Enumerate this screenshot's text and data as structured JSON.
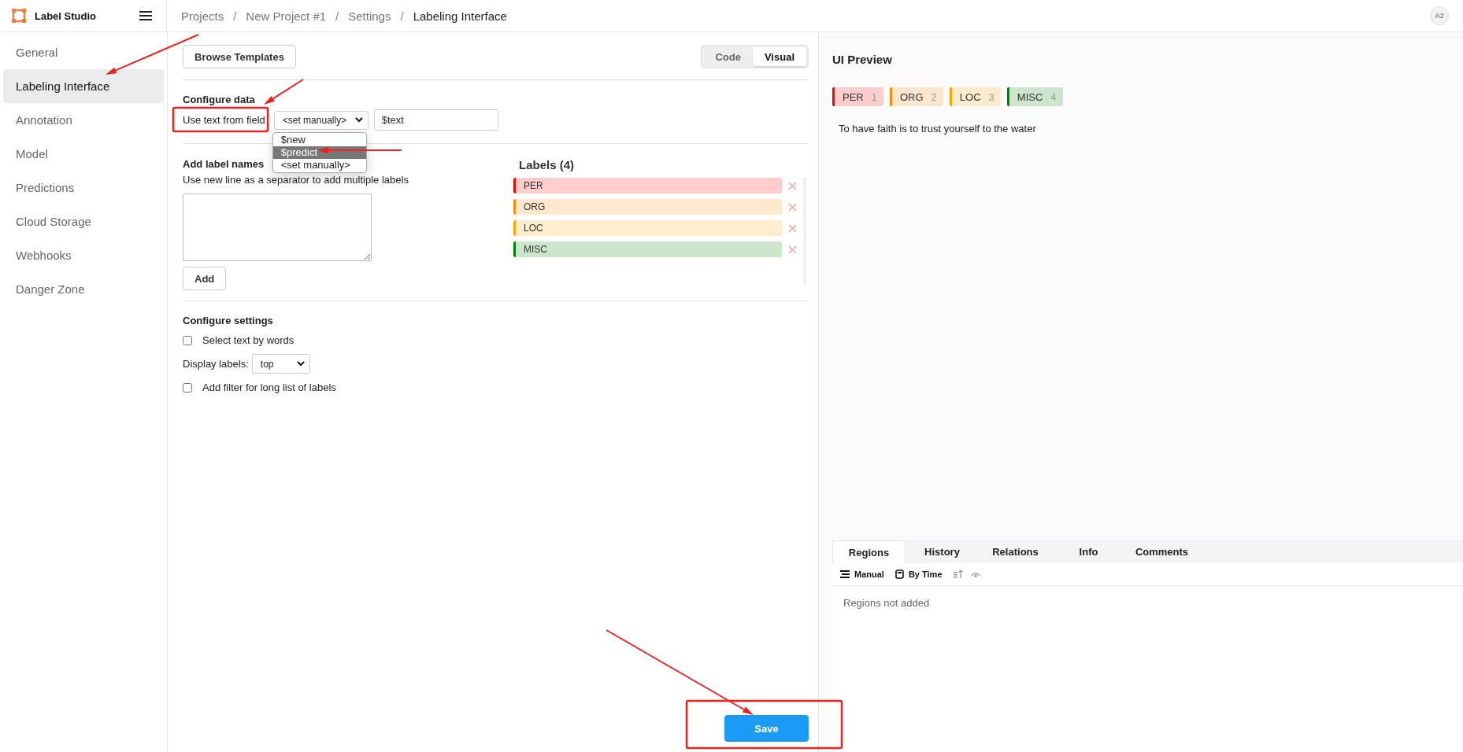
{
  "app": {
    "title": "Label Studio"
  },
  "breadcrumbs": [
    {
      "label": "Projects",
      "separator": "/"
    },
    {
      "label": "New Project #1",
      "separator": "/"
    },
    {
      "label": "Settings",
      "separator": "/"
    },
    {
      "label": "Labeling Interface"
    }
  ],
  "user": {
    "initials": "A2"
  },
  "sidebar": {
    "items": [
      {
        "label": "General",
        "selected": false
      },
      {
        "label": "Labeling Interface",
        "selected": true
      },
      {
        "label": "Annotation",
        "selected": false
      },
      {
        "label": "Model",
        "selected": false
      },
      {
        "label": "Predictions",
        "selected": false
      },
      {
        "label": "Cloud Storage",
        "selected": false
      },
      {
        "label": "Webhooks",
        "selected": false
      },
      {
        "label": "Danger Zone",
        "selected": false
      }
    ]
  },
  "toolbar": {
    "browse_button": "Browse Templates",
    "view_modes": [
      {
        "label": "Code",
        "selected": false
      },
      {
        "label": "Visual",
        "selected": true
      }
    ]
  },
  "configure_data": {
    "heading": "Configure data",
    "field_label": "Use text from field",
    "field_select": {
      "value": "<set manually>",
      "expanded": true,
      "options": [
        {
          "label": "$new",
          "highlighted": false
        },
        {
          "label": "$predict",
          "highlighted": true
        },
        {
          "label": "<set manually>",
          "highlighted": false
        }
      ]
    },
    "field_input": {
      "value": "$text"
    }
  },
  "add_labels": {
    "heading": "Add label names",
    "hint": "Use new line as a separator to add multiple labels",
    "add_button": "Add"
  },
  "labels": {
    "heading": "Labels (4)",
    "items": [
      {
        "name": "PER",
        "color": "#ff0000"
      },
      {
        "name": "ORG",
        "color": "#ff8c00"
      },
      {
        "name": "LOC",
        "color": "#ffa500"
      },
      {
        "name": "MISC",
        "color": "#008000"
      }
    ]
  },
  "configure_settings": {
    "heading": "Configure settings",
    "options": [
      {
        "kind": "checkbox",
        "label": "Select text by words",
        "checked": false
      },
      {
        "kind": "select",
        "label": "Display labels:",
        "value": "top"
      },
      {
        "kind": "checkbox",
        "label": "Add filter for long list of labels",
        "checked": false
      }
    ]
  },
  "save_button": "Save",
  "preview": {
    "title": "UI Preview",
    "tags": [
      {
        "name": "PER",
        "hotkey": "1",
        "color": "#ff0000"
      },
      {
        "name": "ORG",
        "hotkey": "2",
        "color": "#ff8c00"
      },
      {
        "name": "LOC",
        "hotkey": "3",
        "color": "#ffa500"
      },
      {
        "name": "MISC",
        "hotkey": "4",
        "color": "#008000"
      }
    ],
    "text": "To have faith is to trust yourself to the water"
  },
  "side_panel": {
    "tabs": [
      {
        "label": "Regions",
        "selected": true
      },
      {
        "label": "History",
        "selected": false
      },
      {
        "label": "Relations",
        "selected": false
      },
      {
        "label": "Info",
        "selected": false
      },
      {
        "label": "Comments",
        "selected": false
      }
    ],
    "toolbar": [
      {
        "kind": "order",
        "label": "Manual"
      },
      {
        "kind": "grouping",
        "label": "By Time"
      }
    ],
    "empty_message": "Regions not added"
  }
}
